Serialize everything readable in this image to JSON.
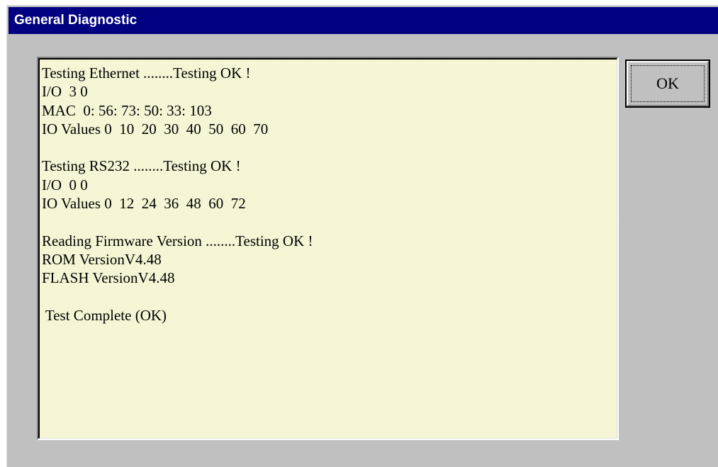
{
  "window": {
    "title": "General Diagnostic"
  },
  "log": {
    "lines": [
      "Testing Ethernet ........Testing OK !",
      "I/O  3 0",
      "MAC  0: 56: 73: 50: 33: 103",
      "IO Values 0  10  20  30  40  50  60  70",
      "",
      "Testing RS232 ........Testing OK !",
      "I/O  0 0",
      "IO Values 0  12  24  36  48  60  72",
      "",
      "Reading Firmware Version ........Testing OK !",
      "ROM VersionV4.48",
      "FLASH VersionV4.48",
      "",
      " Test Complete (OK)"
    ]
  },
  "buttons": {
    "ok_label": "OK"
  },
  "colors": {
    "titlebar": "#000080",
    "dialog_face": "#c0c0c0",
    "log_background": "#ffffe1"
  }
}
